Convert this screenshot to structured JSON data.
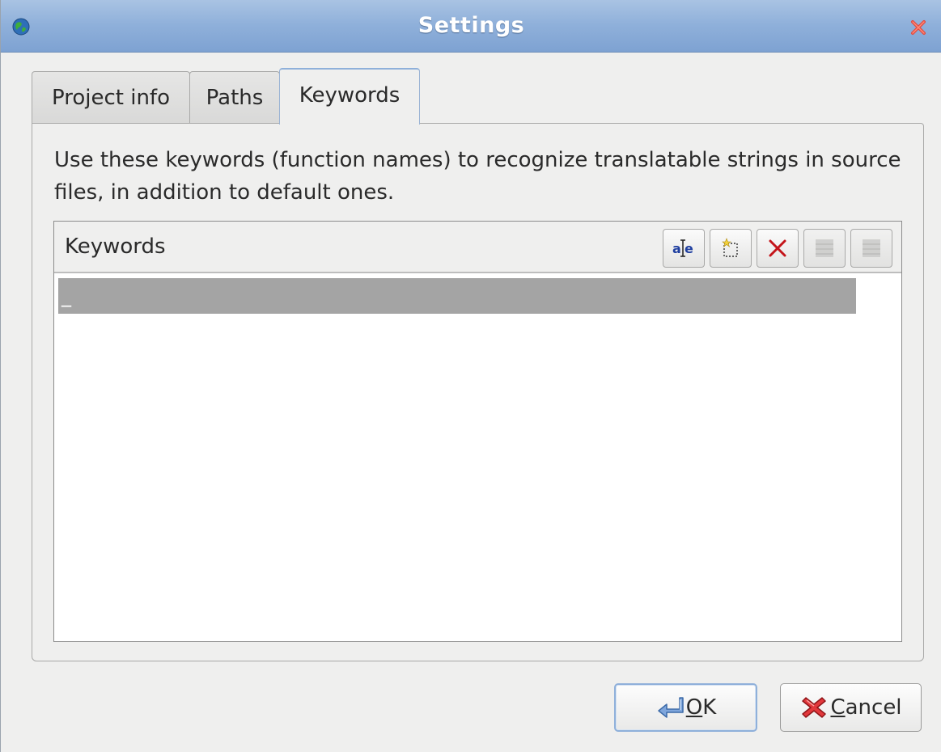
{
  "window": {
    "title": "Settings",
    "app_icon": "globe-icon",
    "close_icon": "close-icon"
  },
  "tabs": [
    {
      "label": "Project info",
      "active": false
    },
    {
      "label": "Paths",
      "active": false
    },
    {
      "label": "Keywords",
      "active": true
    }
  ],
  "keywords_tab": {
    "description": "Use these keywords (function names) to recognize translatable strings in source files, in addition to default ones.",
    "list": {
      "header_label": "Keywords",
      "toolbar": [
        {
          "name": "edit-item-icon",
          "enabled": true
        },
        {
          "name": "new-item-icon",
          "enabled": true
        },
        {
          "name": "delete-item-icon",
          "enabled": true
        },
        {
          "name": "move-up-icon",
          "enabled": false
        },
        {
          "name": "move-down-icon",
          "enabled": false
        }
      ],
      "items": [
        {
          "value": "_",
          "selected": true
        }
      ]
    }
  },
  "buttons": {
    "ok_label": "OK",
    "cancel_label": "Cancel"
  },
  "colors": {
    "titlebar": "#8fb0da",
    "selection": "#a4a4a4",
    "delete_red": "#c4141a"
  }
}
